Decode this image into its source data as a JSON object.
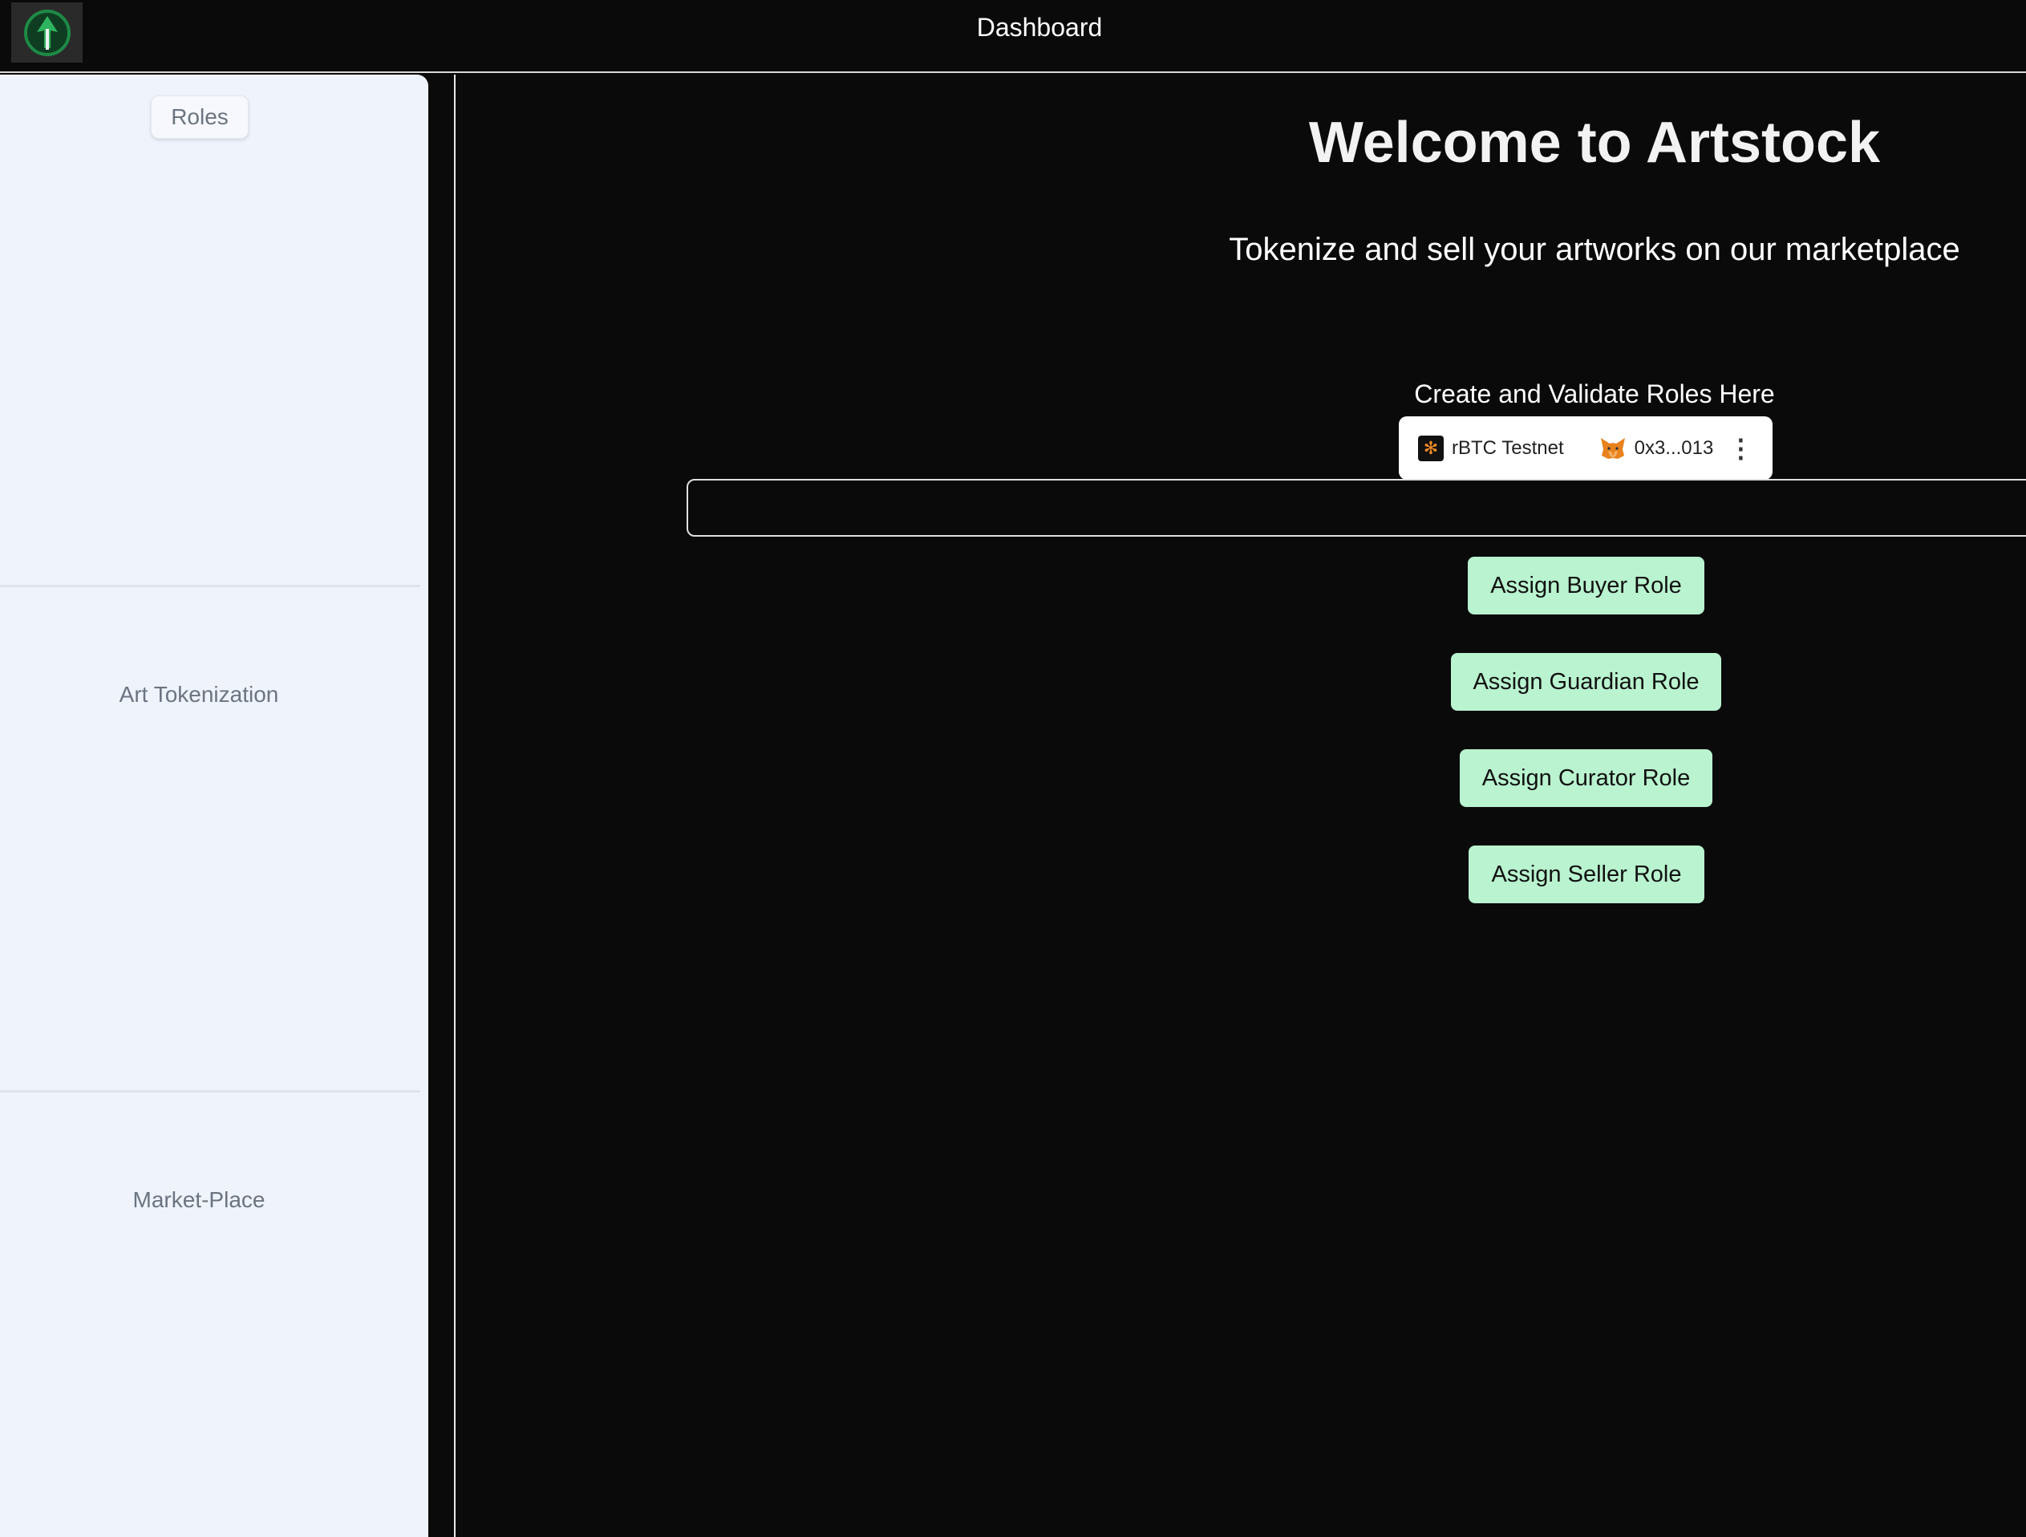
{
  "header": {
    "title": "Dashboard",
    "logo_icon": "tree-logo-icon"
  },
  "sidebar": {
    "items": [
      {
        "label": "Roles"
      },
      {
        "label": "Art Tokenization"
      },
      {
        "label": "Market-Place"
      }
    ]
  },
  "main": {
    "title": "Welcome to Artstock",
    "subtitle": "Tokenize and sell your artworks on our marketplace",
    "section_label": "Create and Validate Roles Here",
    "address_input": {
      "value": "",
      "placeholder": ""
    },
    "buttons": [
      {
        "label": "Assign Buyer Role"
      },
      {
        "label": "Assign Guardian Role"
      },
      {
        "label": "Assign Curator Role"
      },
      {
        "label": "Assign Seller Role"
      }
    ]
  },
  "wallet": {
    "network": "rBTC Testnet",
    "network_icon": "rootstock-icon",
    "account": "0x3...013",
    "account_icon": "metamask-fox-icon",
    "menu_icon": "more-vertical-icon"
  },
  "colors": {
    "background": "#0a0a0a",
    "sidebar": "#eff3fc",
    "button": "#b9f3cf"
  }
}
